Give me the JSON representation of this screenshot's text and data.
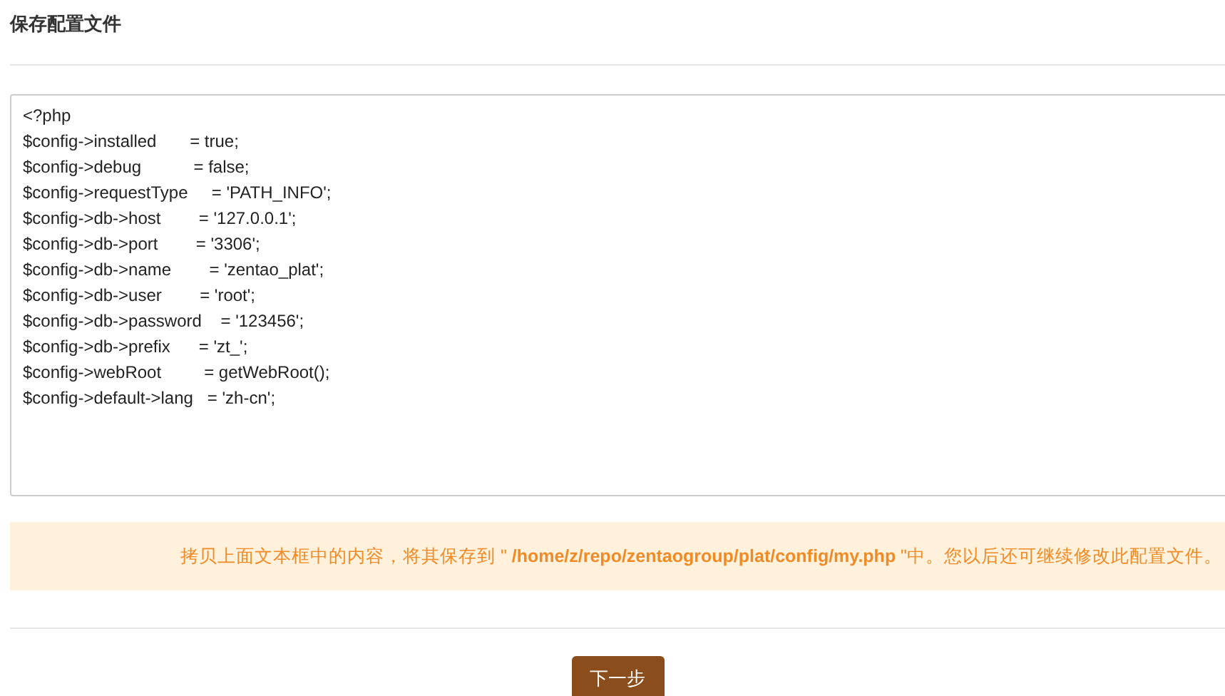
{
  "title": "保存配置文件",
  "config_text": [
    "<?php",
    "$config->installed       = true;",
    "$config->debug           = false;",
    "$config->requestType     = 'PATH_INFO';",
    "$config->db->host        = '127.0.0.1';",
    "$config->db->port        = '3306';",
    "$config->db->name        = 'zentao_plat';",
    "$config->db->user        = 'root';",
    "$config->db->password    = '123456';",
    "$config->db->prefix      = 'zt_';",
    "$config->webRoot         = getWebRoot();",
    "$config->default->lang   = 'zh-cn';"
  ],
  "notice": "拷贝上面文本框中的内容，将其保存到 \" **/home/z/repo/zentaogroup/plat/config/my.php** \"中。您以后还可继续修改此配置文件。",
  "next_button": "下一步"
}
